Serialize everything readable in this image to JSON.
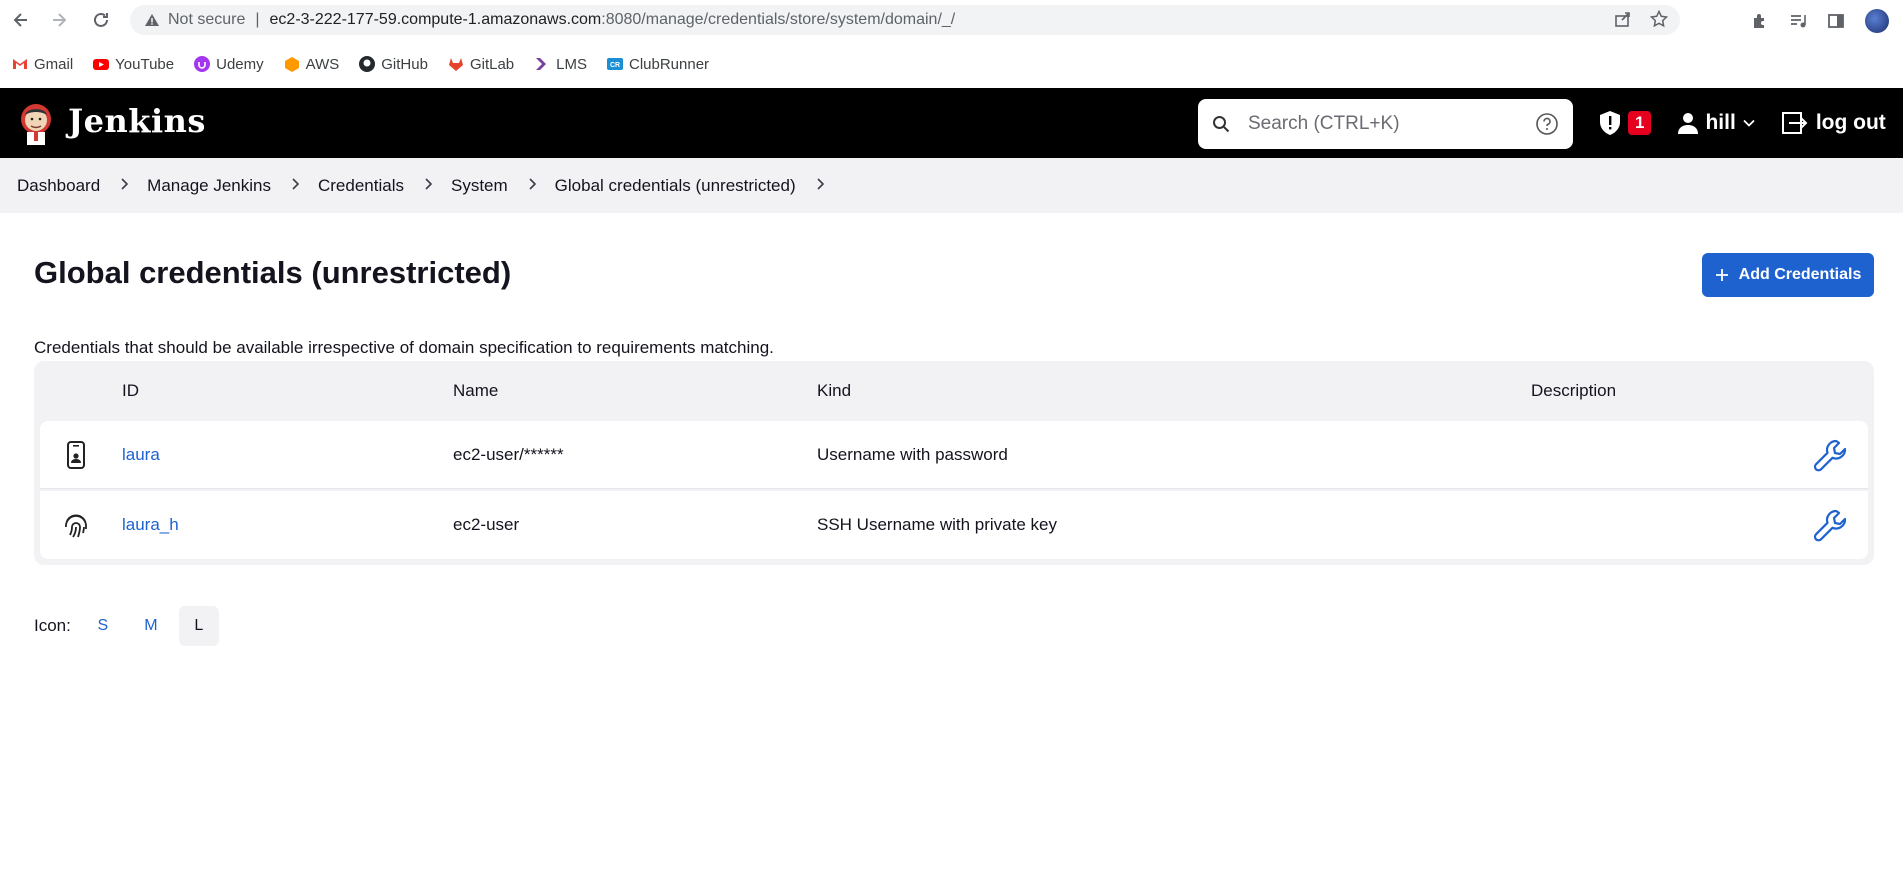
{
  "browser": {
    "security_label": "Not secure",
    "url_host": "ec2-3-222-177-59.compute-1.amazonaws.com",
    "url_path": ":8080/manage/credentials/store/system/domain/_/",
    "bookmarks": [
      {
        "label": "Gmail",
        "color": "#ea4335"
      },
      {
        "label": "YouTube",
        "color": "#ff0000"
      },
      {
        "label": "Udemy",
        "color": "#a435f0"
      },
      {
        "label": "AWS",
        "color": "#ff9900"
      },
      {
        "label": "GitHub",
        "color": "#24292e"
      },
      {
        "label": "GitLab",
        "color": "#e24329"
      },
      {
        "label": "LMS",
        "color": "#7b3fa0"
      },
      {
        "label": "ClubRunner",
        "color": "#1a8fd6"
      }
    ]
  },
  "header": {
    "title": "Jenkins",
    "search_placeholder": "Search (CTRL+K)",
    "security_count": "1",
    "user": "hill",
    "logout": "log out"
  },
  "breadcrumb": [
    "Dashboard",
    "Manage Jenkins",
    "Credentials",
    "System",
    "Global credentials (unrestricted)"
  ],
  "main": {
    "title": "Global credentials (unrestricted)",
    "add_button": "Add Credentials",
    "description": "Credentials that should be available irrespective of domain specification to requirements matching.",
    "columns": {
      "id": "ID",
      "name": "Name",
      "kind": "Kind",
      "description": "Description"
    },
    "rows": [
      {
        "icon": "id-card-icon",
        "id": "laura",
        "name": "ec2-user/******",
        "kind": "Username with password",
        "description": ""
      },
      {
        "icon": "fingerprint-icon",
        "id": "laura_h",
        "name": "ec2-user",
        "kind": "SSH Username with private key",
        "description": ""
      }
    ],
    "icon_label": "Icon:",
    "icon_sizes": [
      "S",
      "M",
      "L"
    ],
    "icon_size_selected": "L"
  },
  "colors": {
    "accent": "#1e62d0",
    "header_bg": "#000000",
    "alert": "#e6001f"
  }
}
